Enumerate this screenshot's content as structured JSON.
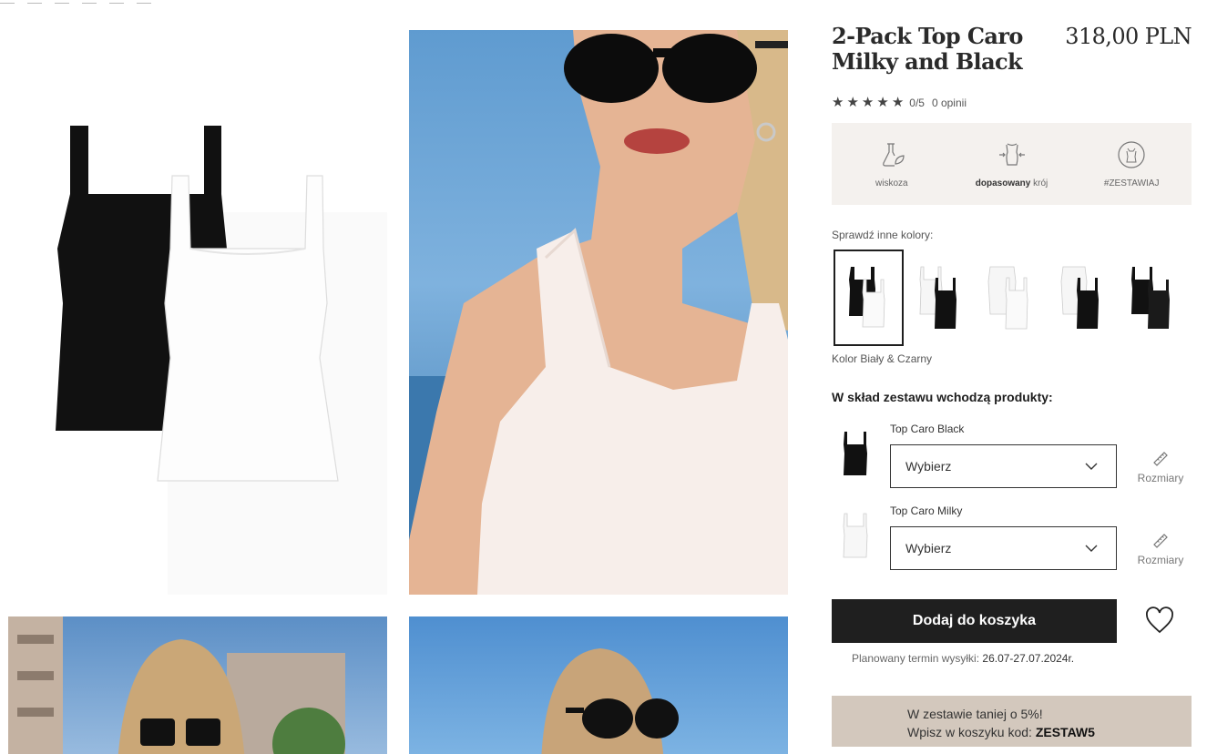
{
  "product": {
    "title": "2-Pack Top Caro Milky and Black",
    "price": "318,00 PLN",
    "rating_score": "0/5",
    "rating_count": "0 opinii"
  },
  "features": [
    {
      "icon": "flask-leaf-icon",
      "label": "wiskoza",
      "bold": ""
    },
    {
      "icon": "fitted-body-icon",
      "label": " krój",
      "bold": "dopasowany"
    },
    {
      "icon": "combine-set-icon",
      "label": "#ZESTAWIAJ",
      "bold": ""
    }
  ],
  "colors": {
    "heading": "Sprawdź inne kolory:",
    "selected_label": "Kolor Biały & Czarny"
  },
  "set": {
    "heading": "W skład zestawu wchodzą produkty:",
    "items": [
      {
        "name": "Top Caro Black",
        "select_value": "Wybierz",
        "sizes_label": "Rozmiary"
      },
      {
        "name": "Top Caro Milky",
        "select_value": "Wybierz",
        "sizes_label": "Rozmiary"
      }
    ]
  },
  "cart": {
    "add_label": "Dodaj do koszyka",
    "shipping_label": "Planowany termin wysyłki:",
    "shipping_date": "26.07-27.07.2024r."
  },
  "promo": {
    "line1": "W zestawie taniej o 5%!",
    "line2_prefix": "Wpisz w koszyku kod: ",
    "code": "ZESTAW5"
  },
  "colors_theme": {
    "button_bg": "#1f1f1f",
    "feature_bg": "#f4f1ee",
    "promo_bg": "#d3c8bd"
  }
}
